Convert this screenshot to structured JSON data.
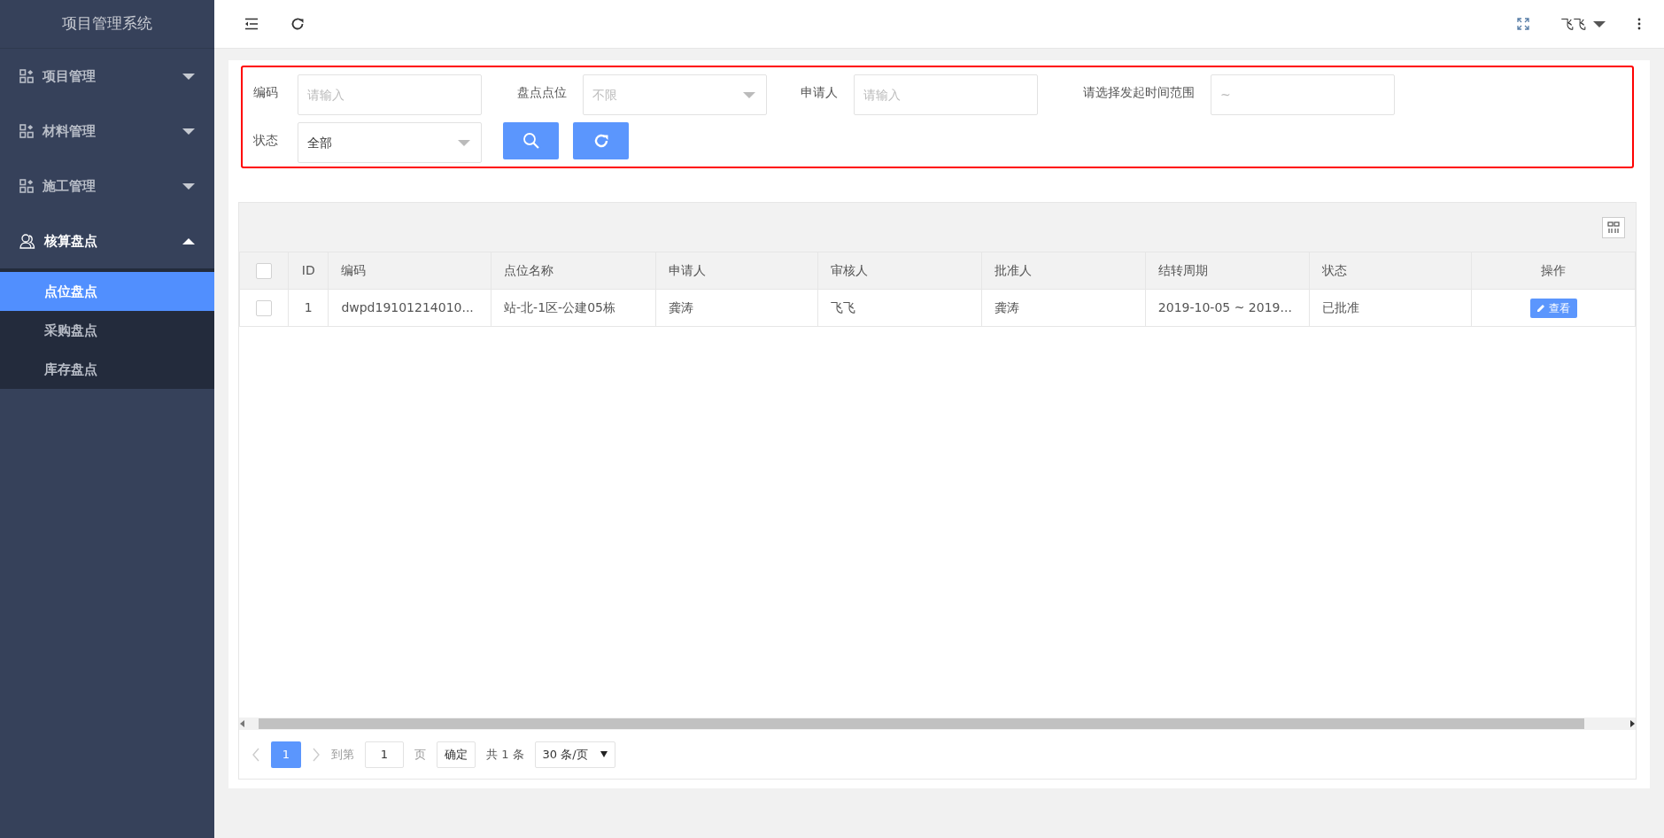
{
  "app_title": "项目管理系统",
  "sidebar": {
    "items": [
      {
        "label": "项目管理",
        "kind": "grid",
        "expanded": false
      },
      {
        "label": "材料管理",
        "kind": "grid",
        "expanded": false
      },
      {
        "label": "施工管理",
        "kind": "grid",
        "expanded": false
      },
      {
        "label": "核算盘点",
        "kind": "user",
        "expanded": true,
        "children": [
          {
            "label": "点位盘点",
            "selected": true
          },
          {
            "label": "采购盘点",
            "selected": false
          },
          {
            "label": "库存盘点",
            "selected": false
          }
        ]
      }
    ]
  },
  "header": {
    "user": "飞飞"
  },
  "filters": [
    {
      "label": "编码",
      "kind": "text",
      "placeholder": "请输入"
    },
    {
      "label": "盘点点位",
      "kind": "select",
      "placeholder": "不限"
    },
    {
      "label": "申请人",
      "kind": "text",
      "placeholder": "请输入"
    },
    {
      "label": "请选择发起时间范围",
      "kind": "range",
      "placeholder": "~"
    },
    {
      "label": "状态",
      "kind": "select",
      "value": "全部"
    }
  ],
  "table": {
    "all_checked": false,
    "columns": [
      "ID",
      "编码",
      "点位名称",
      "申请人",
      "审核人",
      "批准人",
      "结转周期",
      "状态",
      "操作"
    ],
    "rows": [
      {
        "checked": false,
        "cells": [
          "1",
          "dwpd19101214010...",
          "站-北-1区-公建05栋",
          "龚涛",
          "飞飞",
          "龚涛",
          "2019-10-05 ~ 2019...",
          "已批准"
        ],
        "action": "查看"
      }
    ]
  },
  "pagination": {
    "pages": [
      {
        "label": "1",
        "selected": true
      }
    ],
    "goto_prefix": "到第",
    "goto_value": "1",
    "goto_suffix": "页",
    "confirm": "确定",
    "total": "共 1 条",
    "page_size": "30 条/页"
  }
}
